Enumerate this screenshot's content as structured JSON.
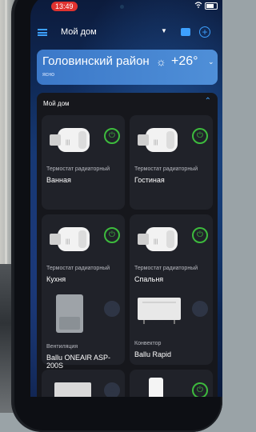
{
  "status": {
    "time": "13:49"
  },
  "appbar": {
    "home": "Мой дом"
  },
  "weather": {
    "district": "Головинский район",
    "condition": "ясно",
    "temp": "+26°"
  },
  "room": {
    "title": "Мой дом"
  },
  "devices": [
    {
      "type": "Термостат радиаторный",
      "name": "Ванная",
      "icon": "radiator-thermostat",
      "on": true
    },
    {
      "type": "Термостат радиаторный",
      "name": "Гостиная",
      "icon": "radiator-thermostat",
      "on": true
    },
    {
      "type": "Термостат радиаторный",
      "name": "Кухня",
      "icon": "radiator-thermostat",
      "on": true
    },
    {
      "type": "Термостат радиаторный",
      "name": "Спальня",
      "icon": "radiator-thermostat",
      "on": true
    },
    {
      "type": "Вентиляция",
      "name": "Ballu ONEAIR ASP-200S",
      "icon": "ventilation-unit",
      "on": false
    },
    {
      "type": "Конвектор",
      "name": "Ballu Rapid",
      "icon": "convector-heater",
      "on": false
    },
    {
      "type": "",
      "name": "",
      "icon": "convector-heater",
      "on": false
    },
    {
      "type": "",
      "name": "",
      "icon": "water-heater",
      "on": true
    }
  ],
  "colors": {
    "accent": "#3da0ff",
    "power_on": "#3dbb3d",
    "time_pill": "#e0322f"
  }
}
